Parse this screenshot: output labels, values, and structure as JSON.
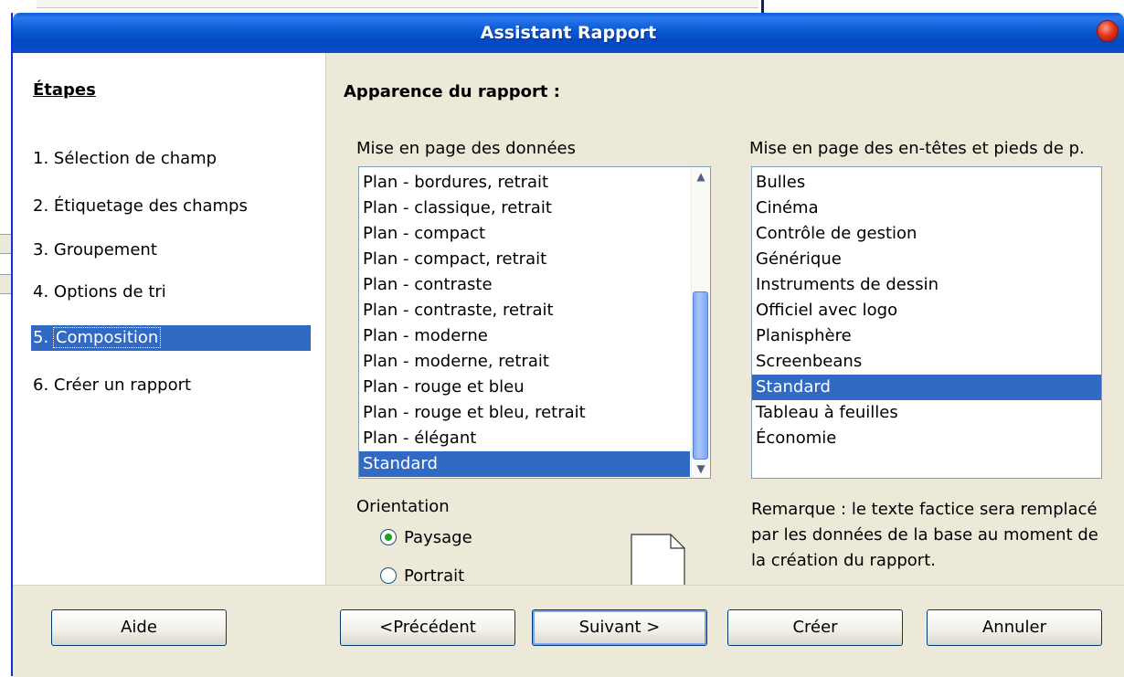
{
  "dialog": {
    "title": "Assistant Rapport"
  },
  "steps": {
    "title": "Étapes",
    "items": [
      {
        "num": "1.",
        "label": "Sélection de champ"
      },
      {
        "num": "2.",
        "label": "Étiquetage des champs"
      },
      {
        "num": "3.",
        "label": "Groupement"
      },
      {
        "num": "4.",
        "label": "Options de tri"
      },
      {
        "num": "5.",
        "label": "Composition",
        "selected": true
      },
      {
        "num": "6.",
        "label": "Créer un rapport"
      }
    ]
  },
  "main": {
    "heading": "Apparence du rapport :",
    "data_layout": {
      "label": "Mise en page des données",
      "items": [
        "Plan - bordures, retrait",
        "Plan - classique, retrait",
        "Plan - compact",
        "Plan - compact, retrait",
        "Plan - contraste",
        "Plan - contraste, retrait",
        "Plan - moderne",
        "Plan - moderne, retrait",
        "Plan - rouge et bleu",
        "Plan - rouge et bleu, retrait",
        "Plan - élégant",
        "Standard"
      ],
      "selected": "Standard"
    },
    "header_layout": {
      "label": "Mise en page des en-têtes et pieds de p.",
      "items": [
        "Bulles",
        "Cinéma",
        "Contrôle de gestion",
        "Générique",
        "Instruments de dessin",
        "Officiel avec logo",
        "Planisphère",
        "Screenbeans",
        "Standard",
        "Tableau à feuilles",
        "Économie"
      ],
      "selected": "Standard"
    },
    "orientation": {
      "label": "Orientation",
      "landscape": "Paysage",
      "portrait": "Portrait",
      "selected": "landscape"
    },
    "note": "Remarque : le texte factice sera remplacé par les données de la base au moment de la création du rapport."
  },
  "buttons": {
    "help": "Aide",
    "previous": "<Précédent",
    "next": "Suivant >",
    "create": "Créer",
    "cancel": "Annuler"
  },
  "colors": {
    "selection": "#316ac5",
    "titlebar": "#0a5ad2",
    "dialog_bg": "#ece9d8"
  }
}
